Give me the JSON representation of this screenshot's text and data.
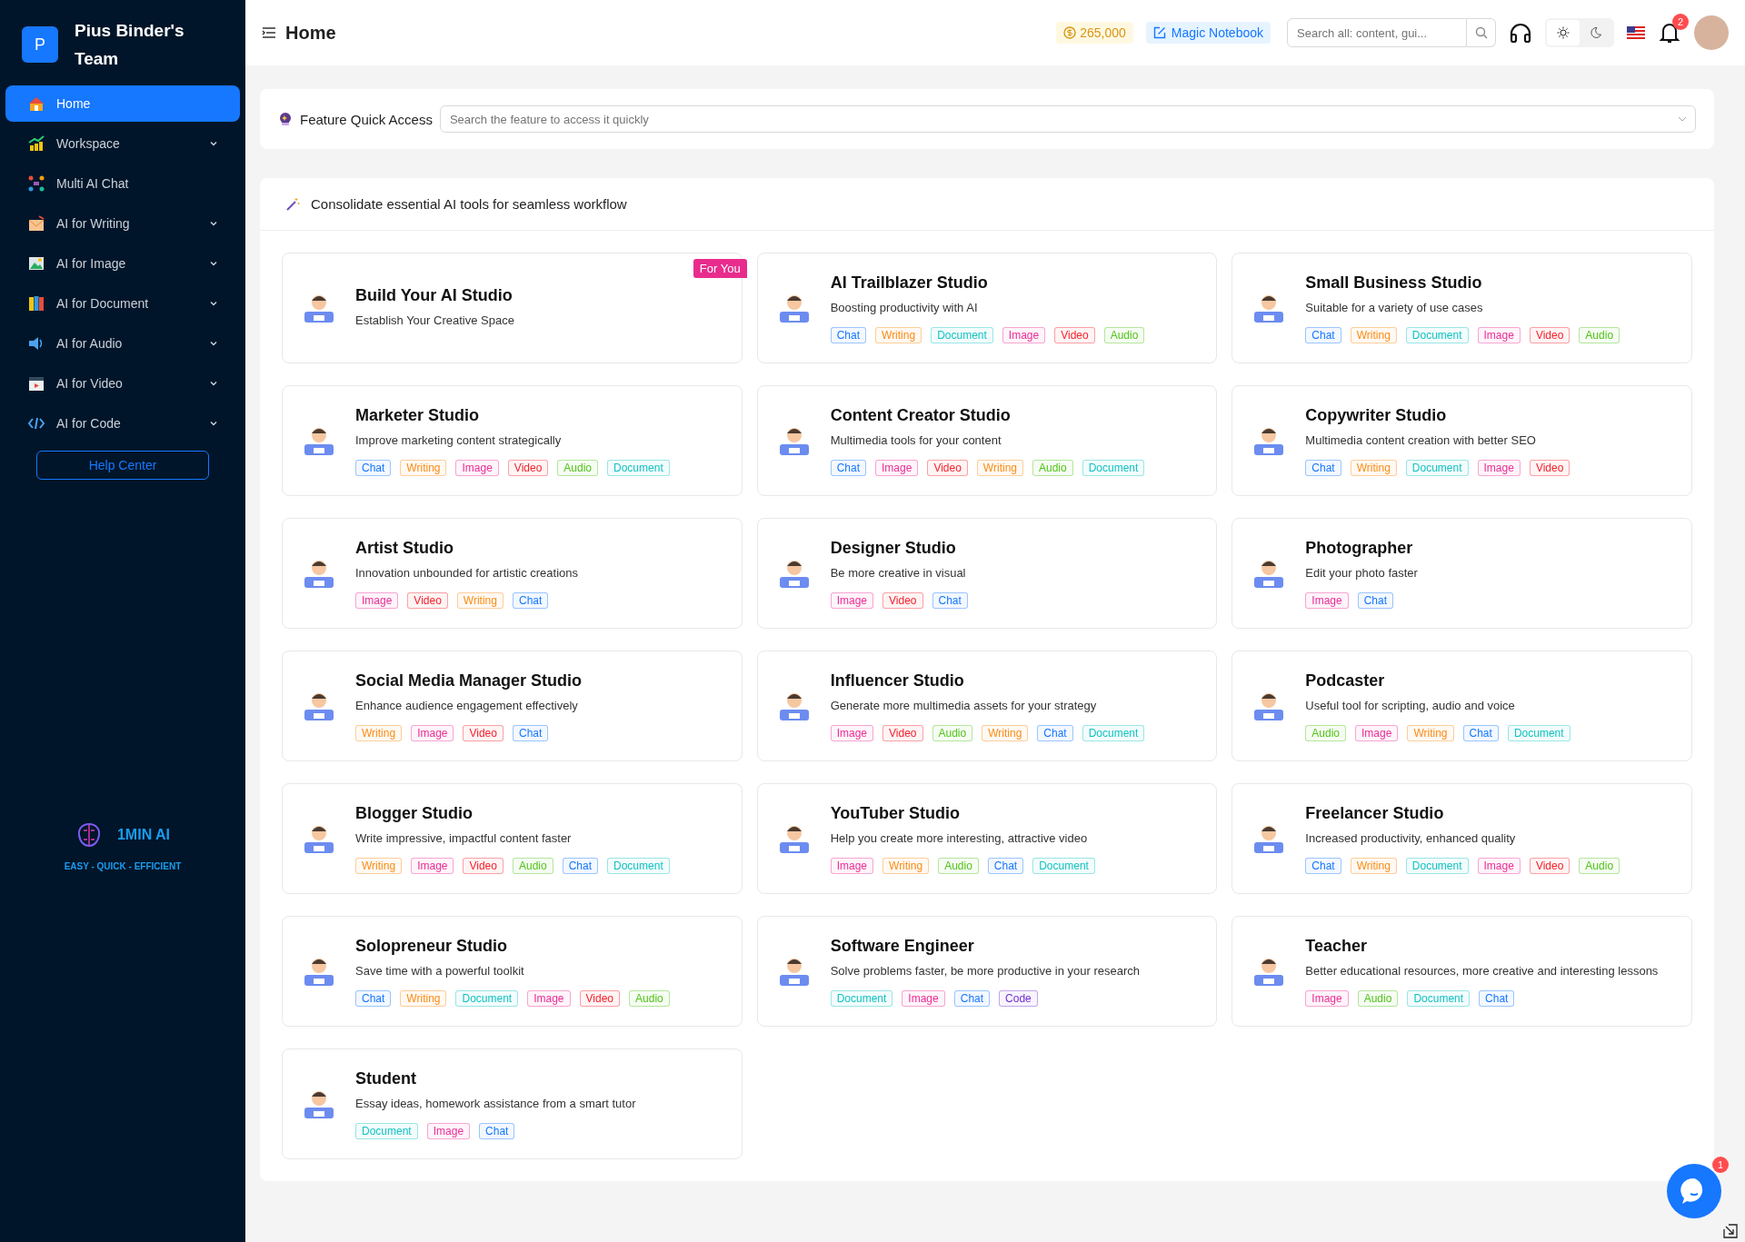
{
  "team": {
    "initial": "P",
    "name": "Pius Binder's Team"
  },
  "sidebar": {
    "items": [
      {
        "label": "Home",
        "selected": true,
        "expandable": false
      },
      {
        "label": "Workspace",
        "selected": false,
        "expandable": true
      },
      {
        "label": "Multi AI Chat",
        "selected": false,
        "expandable": false
      },
      {
        "label": "AI for Writing",
        "selected": false,
        "expandable": true
      },
      {
        "label": "AI for Image",
        "selected": false,
        "expandable": true
      },
      {
        "label": "AI for Document",
        "selected": false,
        "expandable": true
      },
      {
        "label": "AI for Audio",
        "selected": false,
        "expandable": true
      },
      {
        "label": "AI for Video",
        "selected": false,
        "expandable": true
      },
      {
        "label": "AI for Code",
        "selected": false,
        "expandable": true
      }
    ],
    "help_button": "Help Center",
    "brand": {
      "name": "1MIN AI",
      "tagline": "EASY - QUICK - EFFICIENT"
    }
  },
  "header": {
    "title": "Home",
    "credits": "265,000",
    "notebook": "Magic Notebook",
    "search": {
      "placeholder": "Search all: content, gui..."
    },
    "theme_buttons": [
      {
        "selected": true
      },
      {
        "selected": false
      }
    ],
    "notifications": "2"
  },
  "quick_access": {
    "label": "Feature Quick Access",
    "placeholder": "Search the feature to access it quickly"
  },
  "studios": {
    "title": "Consolidate essential AI tools for seamless workflow",
    "cards": [
      {
        "title": "Build Your AI Studio",
        "description": "Establish Your Creative Space",
        "badge": "For You"
      },
      {
        "title": "AI Trailblazer Studio",
        "description": "Boosting productivity with AI",
        "tags": [
          {
            "label": "Chat",
            "color": "#1677ff"
          },
          {
            "label": "Writing",
            "color": "#fa8c16"
          },
          {
            "label": "Document",
            "color": "#13c2c2"
          },
          {
            "label": "Image",
            "color": "#eb2f96"
          },
          {
            "label": "Video",
            "color": "#f5222d"
          },
          {
            "label": "Audio",
            "color": "#52c41a"
          }
        ]
      },
      {
        "title": "Small Business Studio",
        "description": "Suitable for a variety of use cases",
        "tags": [
          {
            "label": "Chat",
            "color": "#1677ff"
          },
          {
            "label": "Writing",
            "color": "#fa8c16"
          },
          {
            "label": "Document",
            "color": "#13c2c2"
          },
          {
            "label": "Image",
            "color": "#eb2f96"
          },
          {
            "label": "Video",
            "color": "#f5222d"
          },
          {
            "label": "Audio",
            "color": "#52c41a"
          }
        ]
      },
      {
        "title": "Marketer Studio",
        "description": "Improve marketing content strategically",
        "tags": [
          {
            "label": "Chat",
            "color": "#1677ff"
          },
          {
            "label": "Writing",
            "color": "#fa8c16"
          },
          {
            "label": "Image",
            "color": "#eb2f96"
          },
          {
            "label": "Video",
            "color": "#f5222d"
          },
          {
            "label": "Audio",
            "color": "#52c41a"
          },
          {
            "label": "Document",
            "color": "#13c2c2"
          }
        ]
      },
      {
        "title": "Content Creator Studio",
        "description": "Multimedia tools for your content",
        "tags": [
          {
            "label": "Chat",
            "color": "#1677ff"
          },
          {
            "label": "Image",
            "color": "#eb2f96"
          },
          {
            "label": "Video",
            "color": "#f5222d"
          },
          {
            "label": "Writing",
            "color": "#fa8c16"
          },
          {
            "label": "Audio",
            "color": "#52c41a"
          },
          {
            "label": "Document",
            "color": "#13c2c2"
          }
        ]
      },
      {
        "title": "Copywriter Studio",
        "description": "Multimedia content creation with better SEO",
        "tags": [
          {
            "label": "Chat",
            "color": "#1677ff"
          },
          {
            "label": "Writing",
            "color": "#fa8c16"
          },
          {
            "label": "Document",
            "color": "#13c2c2"
          },
          {
            "label": "Image",
            "color": "#eb2f96"
          },
          {
            "label": "Video",
            "color": "#f5222d"
          }
        ]
      },
      {
        "title": "Artist Studio",
        "description": "Innovation unbounded for artistic creations",
        "tags": [
          {
            "label": "Image",
            "color": "#eb2f96"
          },
          {
            "label": "Video",
            "color": "#f5222d"
          },
          {
            "label": "Writing",
            "color": "#fa8c16"
          },
          {
            "label": "Chat",
            "color": "#1677ff"
          }
        ]
      },
      {
        "title": "Designer Studio",
        "description": "Be more creative in visual",
        "tags": [
          {
            "label": "Image",
            "color": "#eb2f96"
          },
          {
            "label": "Video",
            "color": "#f5222d"
          },
          {
            "label": "Chat",
            "color": "#1677ff"
          }
        ]
      },
      {
        "title": "Photographer",
        "description": "Edit your photo faster",
        "tags": [
          {
            "label": "Image",
            "color": "#eb2f96"
          },
          {
            "label": "Chat",
            "color": "#1677ff"
          }
        ]
      },
      {
        "title": "Social Media Manager Studio",
        "description": "Enhance audience engagement effectively",
        "tags": [
          {
            "label": "Writing",
            "color": "#fa8c16"
          },
          {
            "label": "Image",
            "color": "#eb2f96"
          },
          {
            "label": "Video",
            "color": "#f5222d"
          },
          {
            "label": "Chat",
            "color": "#1677ff"
          }
        ]
      },
      {
        "title": "Influencer Studio",
        "description": "Generate more multimedia assets for your strategy",
        "tags": [
          {
            "label": "Image",
            "color": "#eb2f96"
          },
          {
            "label": "Video",
            "color": "#f5222d"
          },
          {
            "label": "Audio",
            "color": "#52c41a"
          },
          {
            "label": "Writing",
            "color": "#fa8c16"
          },
          {
            "label": "Chat",
            "color": "#1677ff"
          },
          {
            "label": "Document",
            "color": "#13c2c2"
          }
        ]
      },
      {
        "title": "Podcaster",
        "description": "Useful tool for scripting, audio and voice",
        "tags": [
          {
            "label": "Audio",
            "color": "#52c41a"
          },
          {
            "label": "Image",
            "color": "#eb2f96"
          },
          {
            "label": "Writing",
            "color": "#fa8c16"
          },
          {
            "label": "Chat",
            "color": "#1677ff"
          },
          {
            "label": "Document",
            "color": "#13c2c2"
          }
        ]
      },
      {
        "title": "Blogger Studio",
        "description": "Write impressive, impactful content faster",
        "tags": [
          {
            "label": "Writing",
            "color": "#fa8c16"
          },
          {
            "label": "Image",
            "color": "#eb2f96"
          },
          {
            "label": "Video",
            "color": "#f5222d"
          },
          {
            "label": "Audio",
            "color": "#52c41a"
          },
          {
            "label": "Chat",
            "color": "#1677ff"
          },
          {
            "label": "Document",
            "color": "#13c2c2"
          }
        ]
      },
      {
        "title": "YouTuber Studio",
        "description": "Help you create more interesting, attractive video",
        "tags": [
          {
            "label": "Image",
            "color": "#eb2f96"
          },
          {
            "label": "Writing",
            "color": "#fa8c16"
          },
          {
            "label": "Audio",
            "color": "#52c41a"
          },
          {
            "label": "Chat",
            "color": "#1677ff"
          },
          {
            "label": "Document",
            "color": "#13c2c2"
          }
        ]
      },
      {
        "title": "Freelancer Studio",
        "description": "Increased productivity, enhanced quality",
        "tags": [
          {
            "label": "Chat",
            "color": "#1677ff"
          },
          {
            "label": "Writing",
            "color": "#fa8c16"
          },
          {
            "label": "Document",
            "color": "#13c2c2"
          },
          {
            "label": "Image",
            "color": "#eb2f96"
          },
          {
            "label": "Video",
            "color": "#f5222d"
          },
          {
            "label": "Audio",
            "color": "#52c41a"
          }
        ]
      },
      {
        "title": "Solopreneur Studio",
        "description": "Save time with a powerful toolkit",
        "tags": [
          {
            "label": "Chat",
            "color": "#1677ff"
          },
          {
            "label": "Writing",
            "color": "#fa8c16"
          },
          {
            "label": "Document",
            "color": "#13c2c2"
          },
          {
            "label": "Image",
            "color": "#eb2f96"
          },
          {
            "label": "Video",
            "color": "#f5222d"
          },
          {
            "label": "Audio",
            "color": "#52c41a"
          }
        ]
      },
      {
        "title": "Software Engineer",
        "description": "Solve problems faster, be more productive in your research",
        "tags": [
          {
            "label": "Document",
            "color": "#13c2c2"
          },
          {
            "label": "Image",
            "color": "#eb2f96"
          },
          {
            "label": "Chat",
            "color": "#1677ff"
          },
          {
            "label": "Code",
            "color": "#722ed1"
          }
        ]
      },
      {
        "title": "Teacher",
        "description": "Better educational resources, more creative and interesting lessons",
        "tags": [
          {
            "label": "Image",
            "color": "#eb2f96"
          },
          {
            "label": "Audio",
            "color": "#52c41a"
          },
          {
            "label": "Document",
            "color": "#13c2c2"
          },
          {
            "label": "Chat",
            "color": "#1677ff"
          }
        ]
      },
      {
        "title": "Student",
        "description": "Essay ideas, homework assistance from a smart tutor",
        "tags": [
          {
            "label": "Document",
            "color": "#13c2c2"
          },
          {
            "label": "Image",
            "color": "#eb2f96"
          },
          {
            "label": "Chat",
            "color": "#1677ff"
          }
        ]
      }
    ]
  },
  "chat_widget": {
    "unread": "1"
  }
}
